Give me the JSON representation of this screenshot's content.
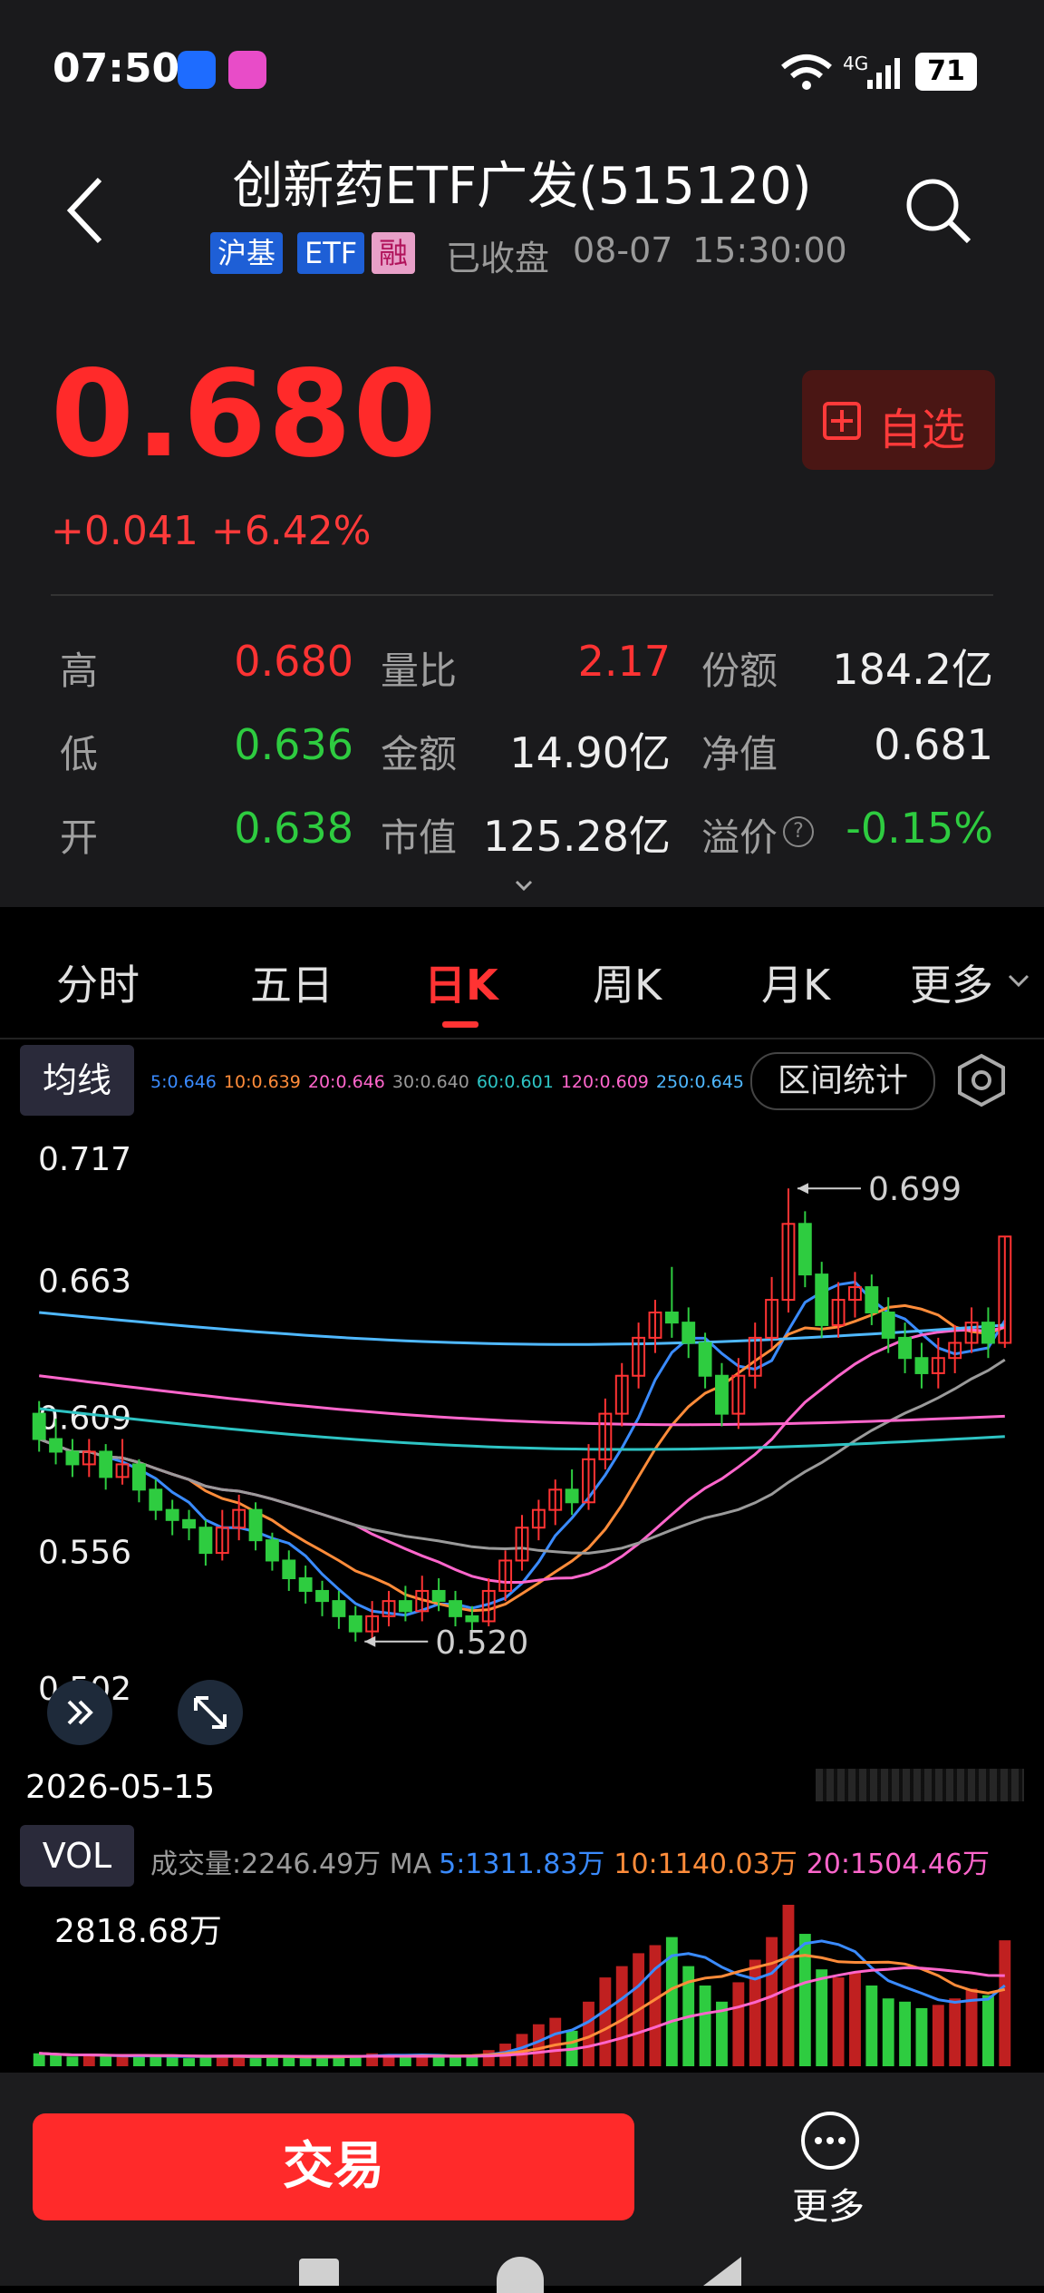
{
  "status_bar": {
    "time": "07:50",
    "network": "4G",
    "battery": "71"
  },
  "header": {
    "title": "创新药ETF广发(515120)",
    "tags": [
      "沪基",
      "ETF",
      "融"
    ],
    "market_status": "已收盘",
    "date": "08-07",
    "time": "15:30:00"
  },
  "quote": {
    "price": "0.680",
    "change": "+0.041",
    "change_pct": "+6.42%",
    "watchlist_label": "自选"
  },
  "stats": [
    {
      "label": "高",
      "value": "0.680",
      "color": "red"
    },
    {
      "label": "量比",
      "value": "2.17",
      "color": "red"
    },
    {
      "label": "份额",
      "value": "184.2亿",
      "color": "white"
    },
    {
      "label": "低",
      "value": "0.636",
      "color": "green"
    },
    {
      "label": "金额",
      "value": "14.90亿",
      "color": "white"
    },
    {
      "label": "净值",
      "value": "0.681",
      "color": "white"
    },
    {
      "label": "开",
      "value": "0.638",
      "color": "green"
    },
    {
      "label": "市值",
      "value": "125.28亿",
      "color": "white"
    },
    {
      "label": "溢价",
      "value": "-0.15%",
      "color": "green"
    }
  ],
  "tabs": [
    "分时",
    "五日",
    "日K",
    "周K",
    "月K",
    "更多"
  ],
  "active_tab": "日K",
  "chart_controls": {
    "ma_button": "均线",
    "interval_button": "区间统计",
    "vol_button": "VOL"
  },
  "ma_legend": [
    {
      "text": "5:0.646",
      "color": "#3a8bff"
    },
    {
      "text": "10:0.639",
      "color": "#ff8c3a"
    },
    {
      "text": "20:0.646",
      "color": "#ff66cc"
    },
    {
      "text": "30:0.640",
      "color": "#9a9a9a"
    },
    {
      "text": "60:0.601",
      "color": "#2ec4c4"
    },
    {
      "text": "120:0.609",
      "color": "#ff66cc"
    },
    {
      "text": "250:0.645",
      "color": "#4fb8ff"
    }
  ],
  "vol_legend": {
    "prefix": "成交量:2246.49万 MA",
    "items": [
      {
        "text": "5:1311.83万",
        "color": "#3a8bff"
      },
      {
        "text": "10:1140.03万",
        "color": "#ff8c3a"
      },
      {
        "text": "20:1504.46万",
        "color": "#ff66cc"
      }
    ]
  },
  "chart_data": {
    "type": "candlestick",
    "y_ticks": [
      "0.717",
      "0.663",
      "0.609",
      "0.556",
      "0.502"
    ],
    "ylim": [
      0.502,
      0.717
    ],
    "start_date": "2026-05-15",
    "annotations": [
      {
        "label": "0.699",
        "value": 0.699,
        "kind": "high"
      },
      {
        "label": "0.520",
        "value": 0.52,
        "kind": "low"
      }
    ],
    "volume_max_label": "2818.68万",
    "candles": [
      [
        0.61,
        0.6,
        0.615,
        0.595
      ],
      [
        0.6,
        0.595,
        0.608,
        0.59
      ],
      [
        0.595,
        0.59,
        0.6,
        0.585
      ],
      [
        0.59,
        0.595,
        0.6,
        0.585
      ],
      [
        0.595,
        0.585,
        0.598,
        0.58
      ],
      [
        0.585,
        0.59,
        0.6,
        0.582
      ],
      [
        0.59,
        0.58,
        0.592,
        0.575
      ],
      [
        0.58,
        0.572,
        0.584,
        0.568
      ],
      [
        0.572,
        0.568,
        0.576,
        0.562
      ],
      [
        0.568,
        0.565,
        0.572,
        0.56
      ],
      [
        0.565,
        0.555,
        0.568,
        0.55
      ],
      [
        0.555,
        0.565,
        0.572,
        0.552
      ],
      [
        0.565,
        0.572,
        0.578,
        0.56
      ],
      [
        0.572,
        0.56,
        0.575,
        0.556
      ],
      [
        0.56,
        0.552,
        0.563,
        0.548
      ],
      [
        0.552,
        0.545,
        0.556,
        0.54
      ],
      [
        0.545,
        0.54,
        0.55,
        0.535
      ],
      [
        0.54,
        0.536,
        0.544,
        0.53
      ],
      [
        0.536,
        0.53,
        0.54,
        0.525
      ],
      [
        0.53,
        0.524,
        0.534,
        0.52
      ],
      [
        0.524,
        0.53,
        0.536,
        0.52
      ],
      [
        0.53,
        0.536,
        0.54,
        0.526
      ],
      [
        0.536,
        0.532,
        0.542,
        0.528
      ],
      [
        0.532,
        0.54,
        0.546,
        0.528
      ],
      [
        0.54,
        0.536,
        0.545,
        0.532
      ],
      [
        0.536,
        0.53,
        0.54,
        0.526
      ],
      [
        0.53,
        0.528,
        0.534,
        0.524
      ],
      [
        0.528,
        0.54,
        0.545,
        0.526
      ],
      [
        0.54,
        0.552,
        0.556,
        0.536
      ],
      [
        0.552,
        0.565,
        0.57,
        0.548
      ],
      [
        0.565,
        0.572,
        0.576,
        0.56
      ],
      [
        0.572,
        0.58,
        0.584,
        0.566
      ],
      [
        0.58,
        0.575,
        0.588,
        0.57
      ],
      [
        0.575,
        0.592,
        0.598,
        0.572
      ],
      [
        0.592,
        0.61,
        0.616,
        0.588
      ],
      [
        0.61,
        0.625,
        0.63,
        0.605
      ],
      [
        0.625,
        0.64,
        0.646,
        0.62
      ],
      [
        0.64,
        0.65,
        0.655,
        0.634
      ],
      [
        0.65,
        0.646,
        0.668,
        0.64
      ],
      [
        0.646,
        0.638,
        0.652,
        0.632
      ],
      [
        0.638,
        0.625,
        0.642,
        0.62
      ],
      [
        0.625,
        0.61,
        0.63,
        0.605
      ],
      [
        0.61,
        0.625,
        0.632,
        0.604
      ],
      [
        0.625,
        0.64,
        0.646,
        0.62
      ],
      [
        0.64,
        0.655,
        0.664,
        0.636
      ],
      [
        0.655,
        0.685,
        0.699,
        0.65
      ],
      [
        0.685,
        0.665,
        0.69,
        0.66
      ],
      [
        0.665,
        0.645,
        0.67,
        0.64
      ],
      [
        0.645,
        0.655,
        0.662,
        0.64
      ],
      [
        0.655,
        0.66,
        0.666,
        0.648
      ],
      [
        0.66,
        0.65,
        0.665,
        0.645
      ],
      [
        0.65,
        0.64,
        0.656,
        0.634
      ],
      [
        0.64,
        0.632,
        0.646,
        0.626
      ],
      [
        0.632,
        0.626,
        0.638,
        0.62
      ],
      [
        0.626,
        0.632,
        0.64,
        0.62
      ],
      [
        0.632,
        0.638,
        0.645,
        0.626
      ],
      [
        0.638,
        0.646,
        0.652,
        0.634
      ],
      [
        0.646,
        0.638,
        0.652,
        0.632
      ],
      [
        0.638,
        0.68,
        0.68,
        0.636
      ]
    ],
    "volumes": [
      0.08,
      0.07,
      0.06,
      0.07,
      0.06,
      0.06,
      0.07,
      0.06,
      0.06,
      0.05,
      0.06,
      0.07,
      0.06,
      0.05,
      0.06,
      0.06,
      0.05,
      0.06,
      0.06,
      0.07,
      0.08,
      0.07,
      0.06,
      0.07,
      0.06,
      0.06,
      0.07,
      0.1,
      0.14,
      0.2,
      0.26,
      0.3,
      0.22,
      0.4,
      0.55,
      0.62,
      0.7,
      0.75,
      0.8,
      0.62,
      0.5,
      0.4,
      0.52,
      0.66,
      0.8,
      1.0,
      0.82,
      0.6,
      0.55,
      0.58,
      0.5,
      0.42,
      0.4,
      0.36,
      0.38,
      0.42,
      0.48,
      0.44,
      0.78
    ]
  }
}
